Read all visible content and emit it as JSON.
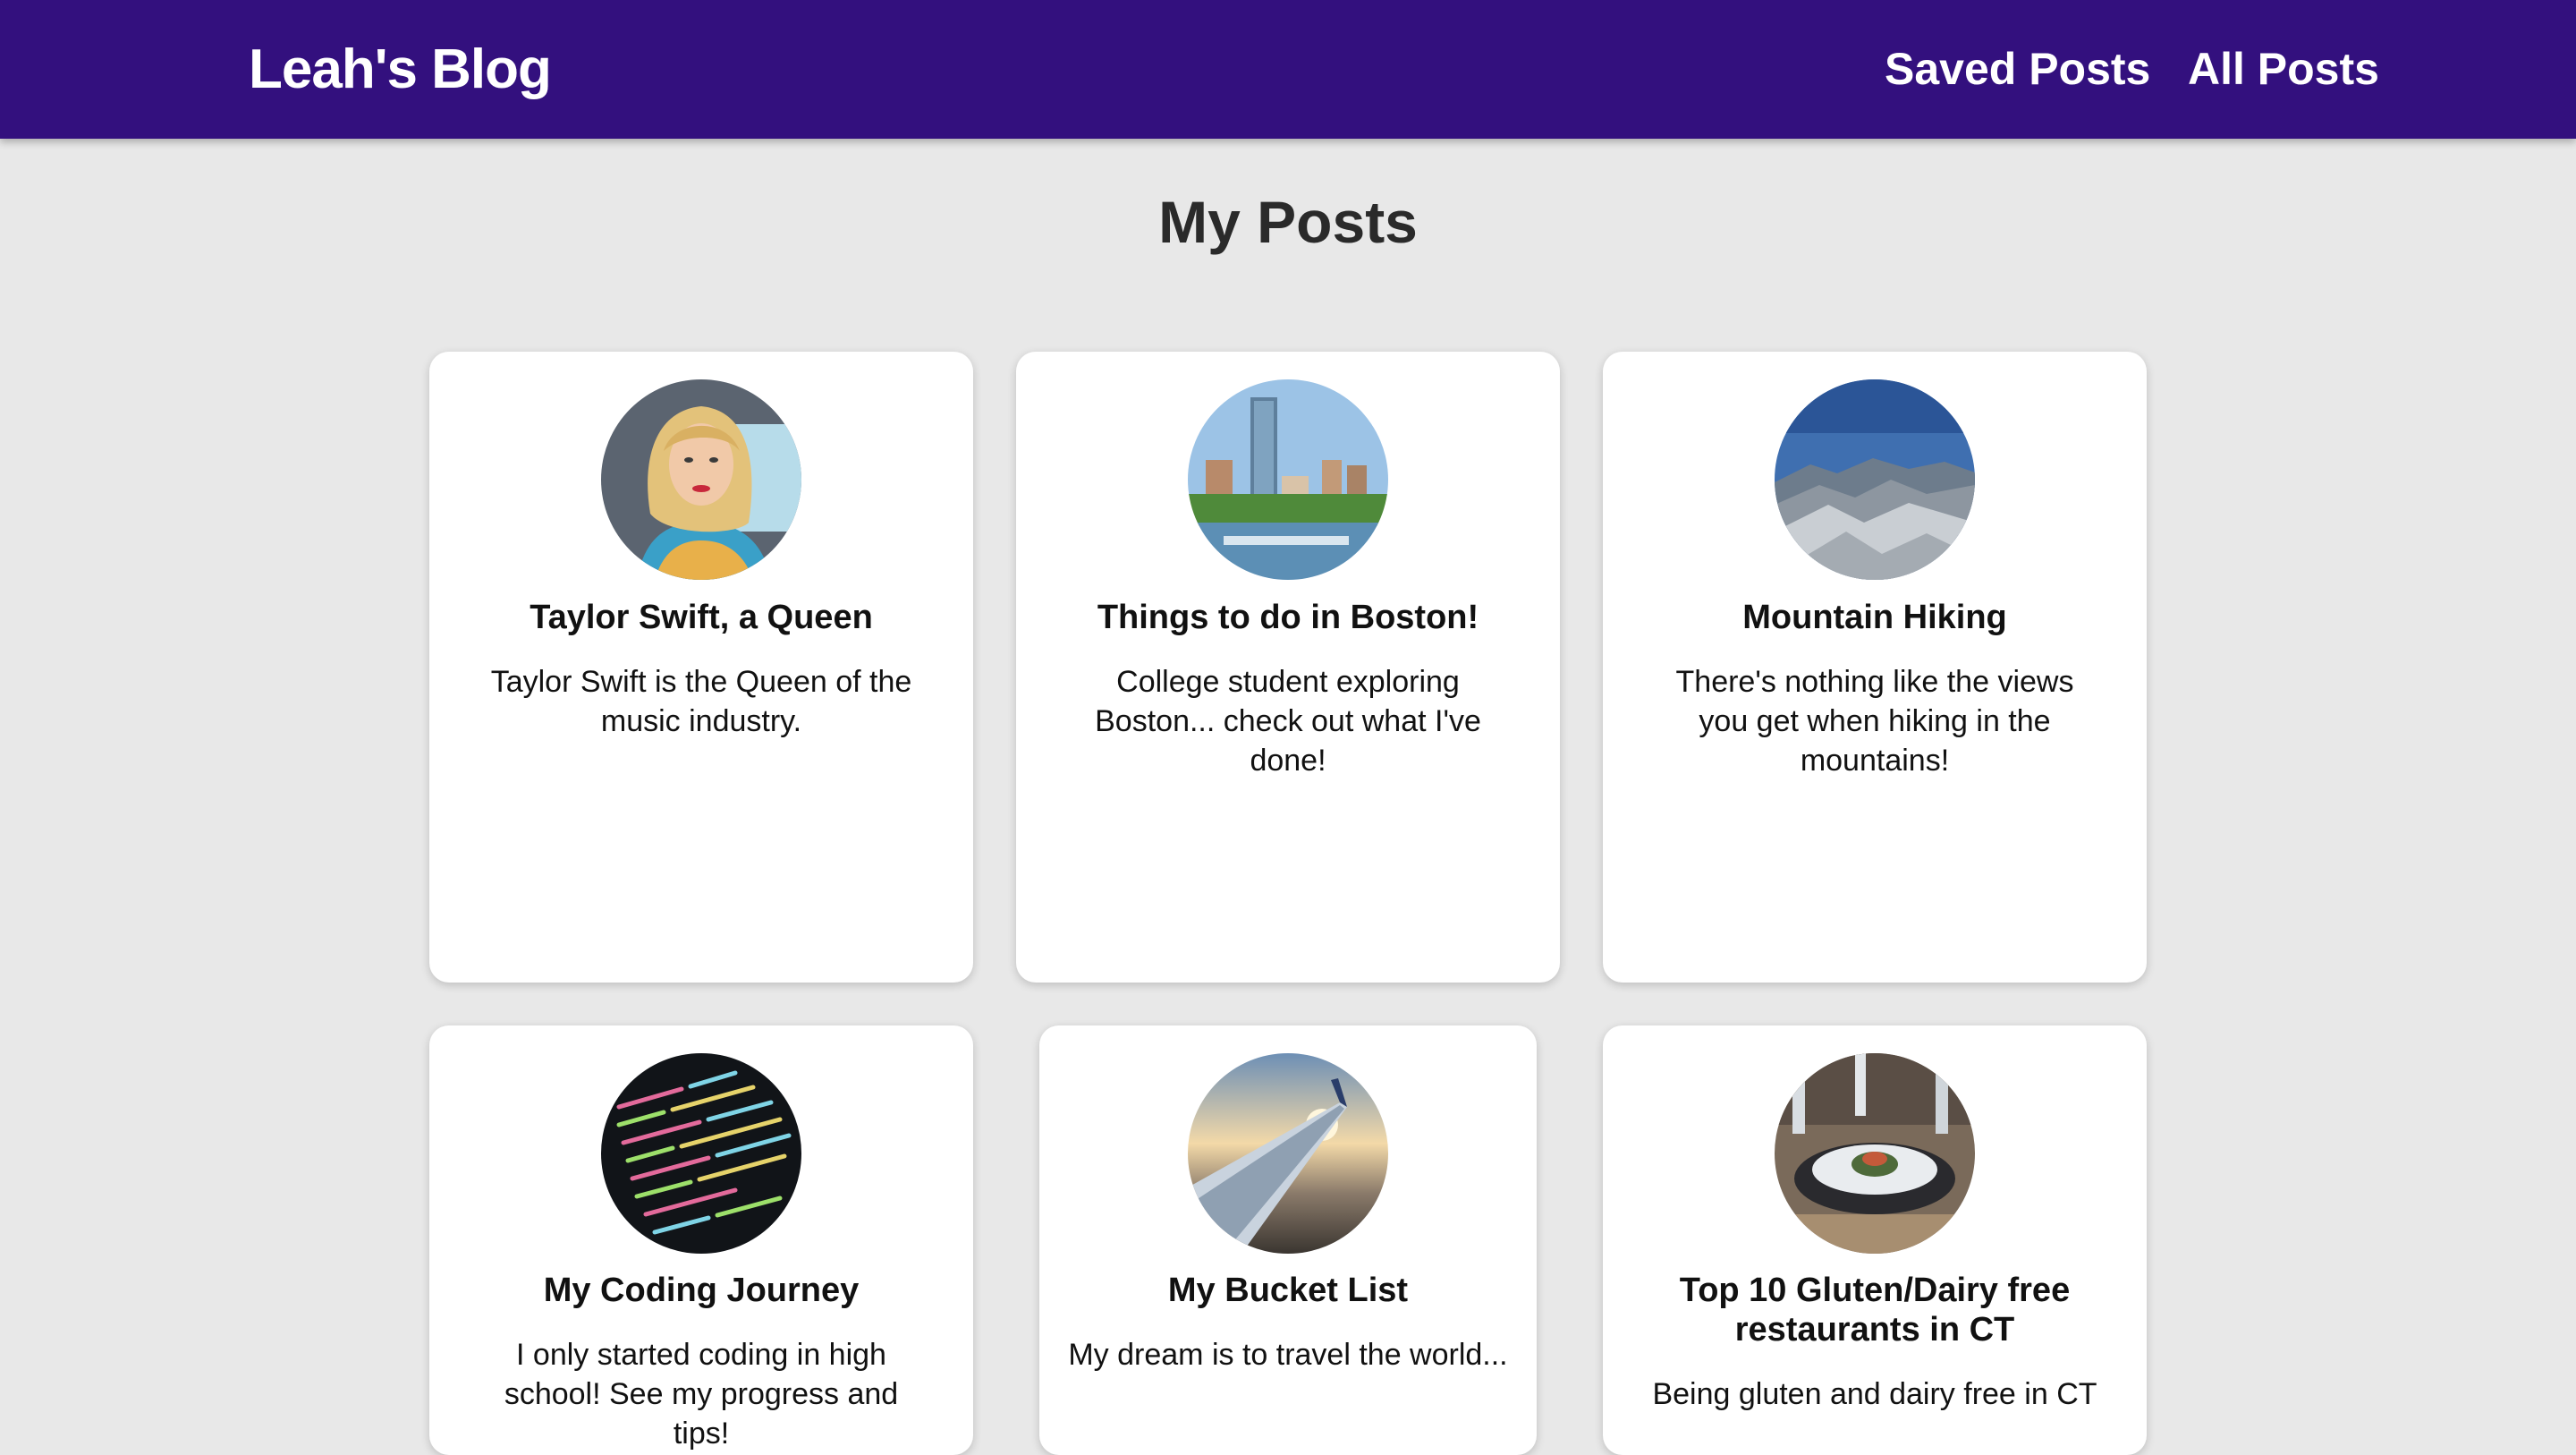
{
  "header": {
    "brand": "Leah's Blog",
    "nav": {
      "saved": "Saved Posts",
      "all": "All Posts"
    },
    "background": "#33107e"
  },
  "page": {
    "title": "My Posts"
  },
  "posts": [
    {
      "title": "Taylor Swift, a Queen",
      "description": "Taylor Swift is the Queen of the music industry.",
      "image": "taylor-swift-portrait"
    },
    {
      "title": "Things to do in Boston!",
      "description": "College student exploring Boston... check out what I've done!",
      "image": "boston-skyline"
    },
    {
      "title": "Mountain Hiking",
      "description": "There's nothing like the views you get when hiking in the mountains!",
      "image": "mountain-range"
    },
    {
      "title": "My Coding Journey",
      "description": "I only started coding in high school! See my progress and tips!",
      "image": "code-screen"
    },
    {
      "title": "My Bucket List",
      "description": "My dream is to travel the world...",
      "image": "airplane-wing"
    },
    {
      "title": "Top 10 Gluten/Dairy free restaurants in CT",
      "description": "Being gluten and dairy free in CT",
      "image": "restaurant-dish"
    }
  ]
}
